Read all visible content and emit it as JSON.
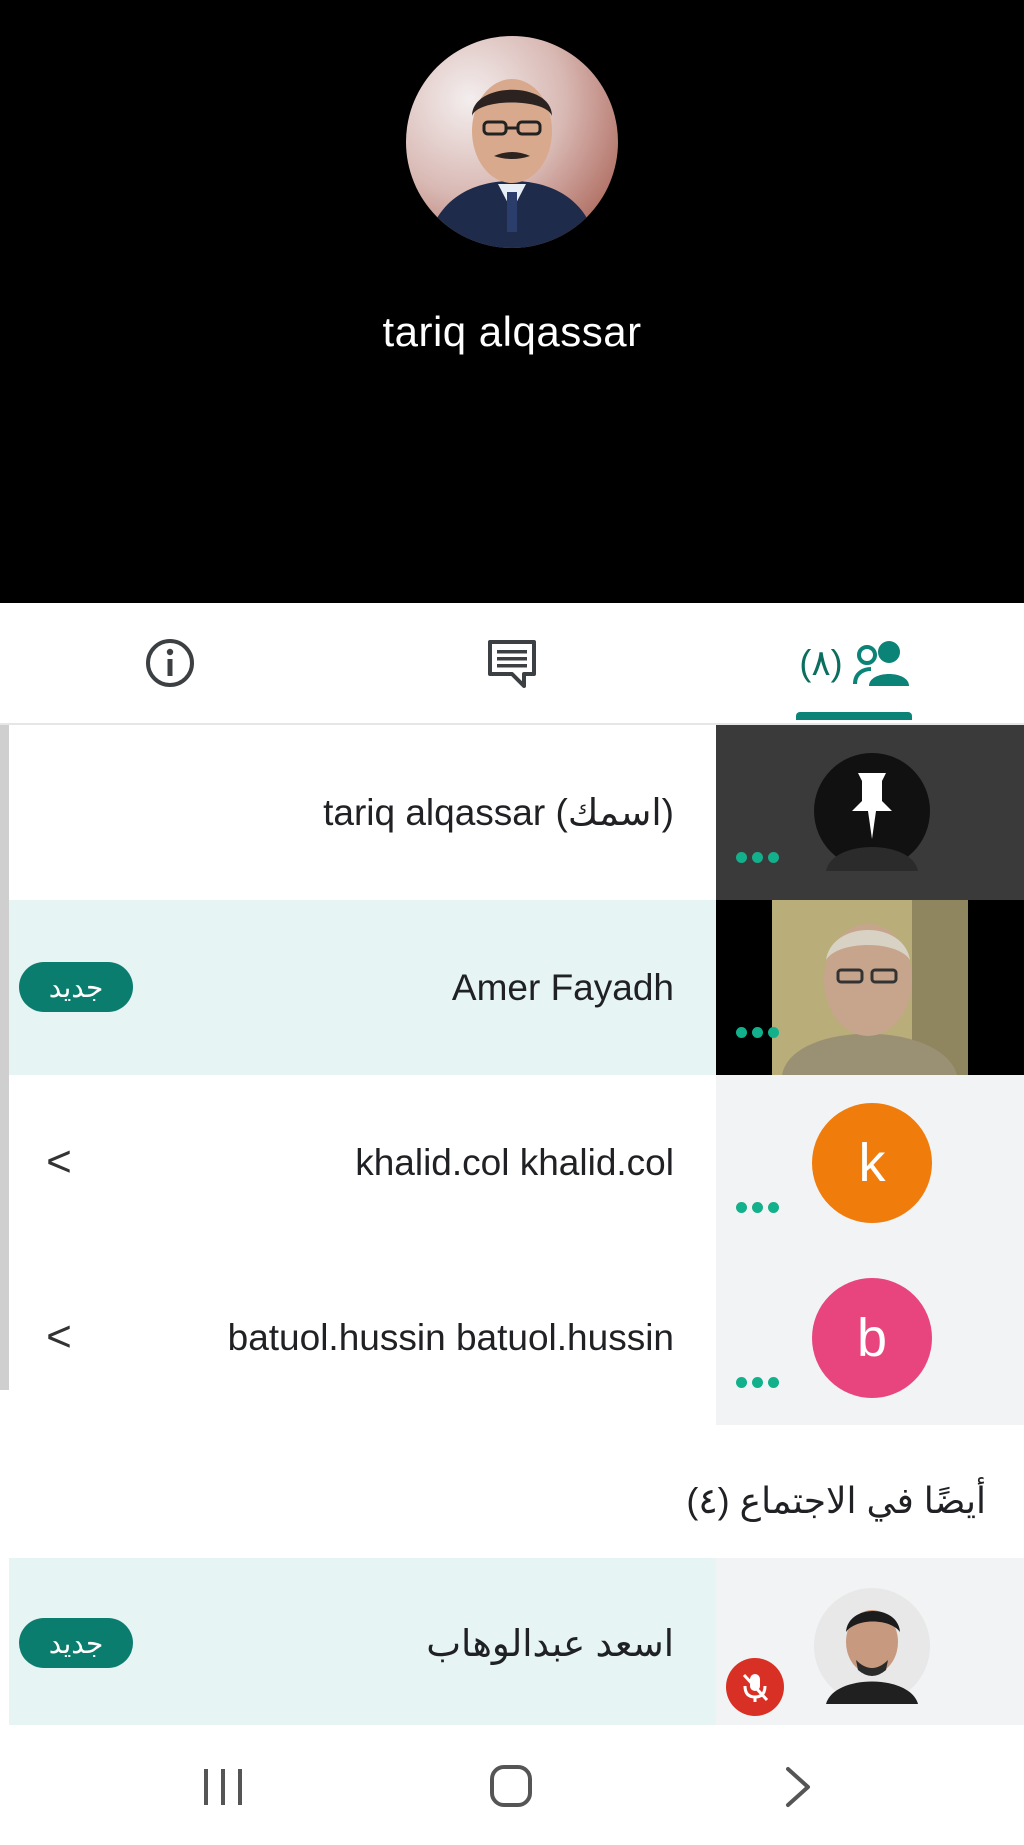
{
  "presenter": {
    "name": "tariq alqassar",
    "avatar_icon": "user-photo"
  },
  "tabs": {
    "info_icon": "info-icon",
    "chat_icon": "chat-icon",
    "people_icon": "people-icon",
    "people_count": "(٨)"
  },
  "participants": [
    {
      "name": "tariq alqassar (اسمك)",
      "tile": "pin-photo",
      "badge": "",
      "expand": ""
    },
    {
      "name": "Amer Fayadh",
      "tile": "video",
      "badge": "جديد",
      "expand": ""
    },
    {
      "name": "khalid.col khalid.col",
      "tile_letter": "k",
      "tile_color": "#f07c0c",
      "badge": "",
      "expand": "<"
    },
    {
      "name": "batuol.hussin batuol.hussin",
      "tile_letter": "b",
      "tile_color": "#e8457e",
      "badge": "",
      "expand": "<"
    }
  ],
  "also_in_meeting": {
    "title": "أيضًا في الاجتماع (٤)",
    "items": [
      {
        "name": "اسعد عبدالوهاب",
        "badge": "جديد",
        "muted": true
      }
    ]
  },
  "colors": {
    "accent": "#0b8377",
    "badge": "#0b7d6e",
    "highlight_row": "#e6f4f3",
    "mute": "#d93025"
  }
}
